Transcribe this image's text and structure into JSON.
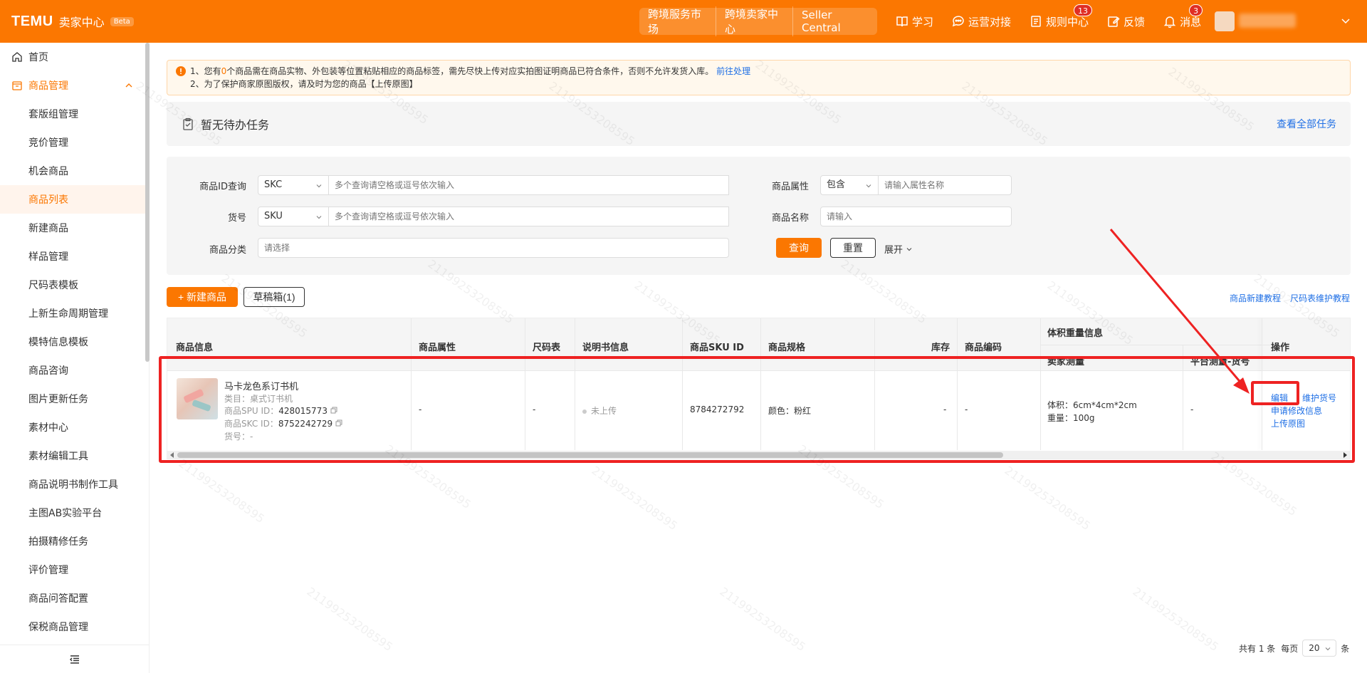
{
  "topbar": {
    "logo": "TEMU",
    "logo_sub": "卖家中心",
    "beta": "Beta",
    "links": [
      "跨境服务市场",
      "跨境卖家中心",
      "Seller Central"
    ],
    "nav": [
      {
        "label": "学习",
        "icon": "book-icon"
      },
      {
        "label": "运营对接",
        "icon": "chat-icon"
      },
      {
        "label": "规则中心",
        "icon": "document-icon",
        "badge": "13"
      },
      {
        "label": "反馈",
        "icon": "edit-icon"
      },
      {
        "label": "消息",
        "icon": "bell-icon",
        "badge": "3"
      }
    ]
  },
  "sidebar": {
    "home": "首页",
    "group": "商品管理",
    "items": [
      "套版组管理",
      "竞价管理",
      "机会商品",
      "商品列表",
      "新建商品",
      "样品管理",
      "尺码表模板",
      "上新生命周期管理",
      "模特信息模板",
      "商品咨询",
      "图片更新任务",
      "素材中心",
      "素材编辑工具",
      "商品说明书制作工具",
      "主图AB实验平台",
      "拍摄精修任务",
      "评价管理",
      "商品问答配置",
      "保税商品管理"
    ],
    "active_index": 3
  },
  "notice": {
    "line1_a": "1、您有",
    "line1_count": "0",
    "line1_b": "个商品需在商品实物、外包装等位置粘贴相应的商品标签，需先尽快上传对应实拍图证明商品已符合条件，否则不允许发货入库。",
    "line1_link": "前往处理",
    "line2": "2、为了保护商家原图版权，请及时为您的商品【上传原图】"
  },
  "todo": {
    "title": "暂无待办任务",
    "link": "查看全部任务"
  },
  "filter": {
    "id_label": "商品ID查询",
    "id_type": "SKC",
    "id_placeholder": "多个查询请空格或逗号依次输入",
    "sku_label": "货号",
    "sku_type": "SKU",
    "sku_placeholder": "多个查询请空格或逗号依次输入",
    "category_label": "商品分类",
    "category_placeholder": "请选择",
    "attr_label": "商品属性",
    "attr_type": "包含",
    "attr_placeholder": "请输入属性名称",
    "name_label": "商品名称",
    "name_placeholder": "请输入",
    "query": "查询",
    "reset": "重置",
    "expand": "展开"
  },
  "actions": {
    "new_product": "+ 新建商品",
    "drafts": "草稿箱(1)",
    "tutorial_new": "商品新建教程",
    "tutorial_size": "尺码表维护教程"
  },
  "table": {
    "headers": {
      "info": "商品信息",
      "attr": "商品属性",
      "size": "尺码表",
      "manual": "说明书信息",
      "sku_id": "商品SKU ID",
      "spec": "商品规格",
      "stock": "库存",
      "code": "商品编码",
      "volume_group": "体积重量信息",
      "seller_measure": "卖家测量",
      "platform_measure": "平台测量-货号",
      "ops": "操作"
    },
    "row": {
      "name": "马卡龙色系订书机",
      "category": "类目：桌式订书机",
      "spu_label": "商品SPU ID：",
      "spu": "428015773",
      "skc_label": "商品SKC ID：",
      "skc": "8752242729",
      "goods_no": "货号：-",
      "attr": "-",
      "size": "-",
      "manual": "未上传",
      "sku_id": "8784272792",
      "spec": "颜色：粉红",
      "stock": "-",
      "code": "-",
      "volume": "体积：6cm*4cm*2cm",
      "weight": "重量：100g",
      "platform": "-",
      "op_edit": "编辑",
      "op_maintain": "维护货号",
      "op_apply": "申请修改信息",
      "op_upload": "上传原图"
    }
  },
  "pager": {
    "total": "共有 1 条",
    "per_page_label": "每页",
    "per_page": "20",
    "unit": "条"
  },
  "watermark": "21199253208595",
  "colors": {
    "brand": "#fb7701",
    "link": "#1f6fe5",
    "annotation": "#ee2222"
  }
}
